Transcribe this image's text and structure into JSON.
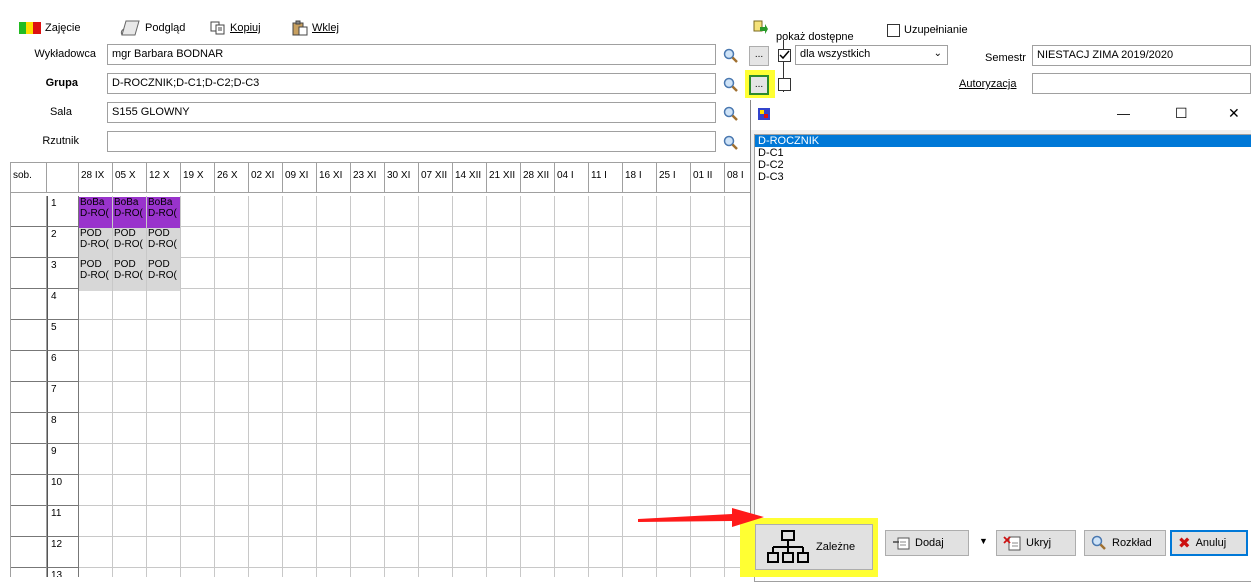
{
  "toolbar": {
    "zajecie": "Zajęcie",
    "podglad": "Podgląd",
    "kopiuj": "Kopiuj",
    "wklej": "Wklej"
  },
  "form": {
    "wykladowca_label": "Wykładowca",
    "wykladowca_value": "mgr Barbara BODNAR",
    "grupa_label": "Grupa",
    "grupa_value": "D-ROCZNIK;D-C1;D-C2;D-C3",
    "sala_label": "Sala",
    "sala_value": "S155 GLOWNY",
    "rzutnik_label": "Rzutnik",
    "rzutnik_value": "",
    "ellipsis": "..."
  },
  "right": {
    "pokaz_dostepne": "pokaż dostępne",
    "uzupelnianie": "Uzupełnianie",
    "dropdown_value": "dla wszystkich",
    "semestr_label": "Semestr",
    "semestr_value": "NIESTACJ ZIMA 2019/2020",
    "autoryzacja_label": "Autoryzacja",
    "autoryzacja_value": ""
  },
  "grid": {
    "corner": "sob.",
    "columns": [
      "28 IX",
      "05 X",
      "12 X",
      "19 X",
      "26 X",
      "02 XI",
      "09 XI",
      "16 XI",
      "23 XI",
      "30 XI",
      "07 XII",
      "14 XII",
      "21 XII",
      "28 XII",
      "04 I",
      "11 I",
      "18 I",
      "25 I",
      "01 II",
      "08 I"
    ],
    "rows": [
      "1",
      "2",
      "3",
      "4",
      "5",
      "6",
      "7",
      "8",
      "9",
      "10",
      "11",
      "12",
      "13"
    ],
    "row1": {
      "top": "BoBa",
      "bottom": "D-RO("
    },
    "row2": {
      "top": "POD",
      "bottom": "D-RO("
    },
    "row3": {
      "top": "POD",
      "bottom": "D-RO("
    }
  },
  "popup": {
    "minimize": "—",
    "maximize": "☐",
    "close": "✕",
    "items": [
      "D-ROCZNIK",
      "D-C1",
      "D-C2",
      "D-C3"
    ],
    "selected_index": 0,
    "buttons": {
      "zalezne": "Zależne",
      "dodaj": "Dodaj",
      "ukryj": "Ukryj",
      "rozklad": "Rozkład",
      "anuluj": "Anuluj"
    }
  },
  "colors": {
    "highlight_yellow": "#ffff33",
    "arrow_red": "#ff1a1a",
    "selection_blue": "#0078d7",
    "lesson_purple": "#9933cc",
    "lesson_gray": "#d7d7d7"
  }
}
